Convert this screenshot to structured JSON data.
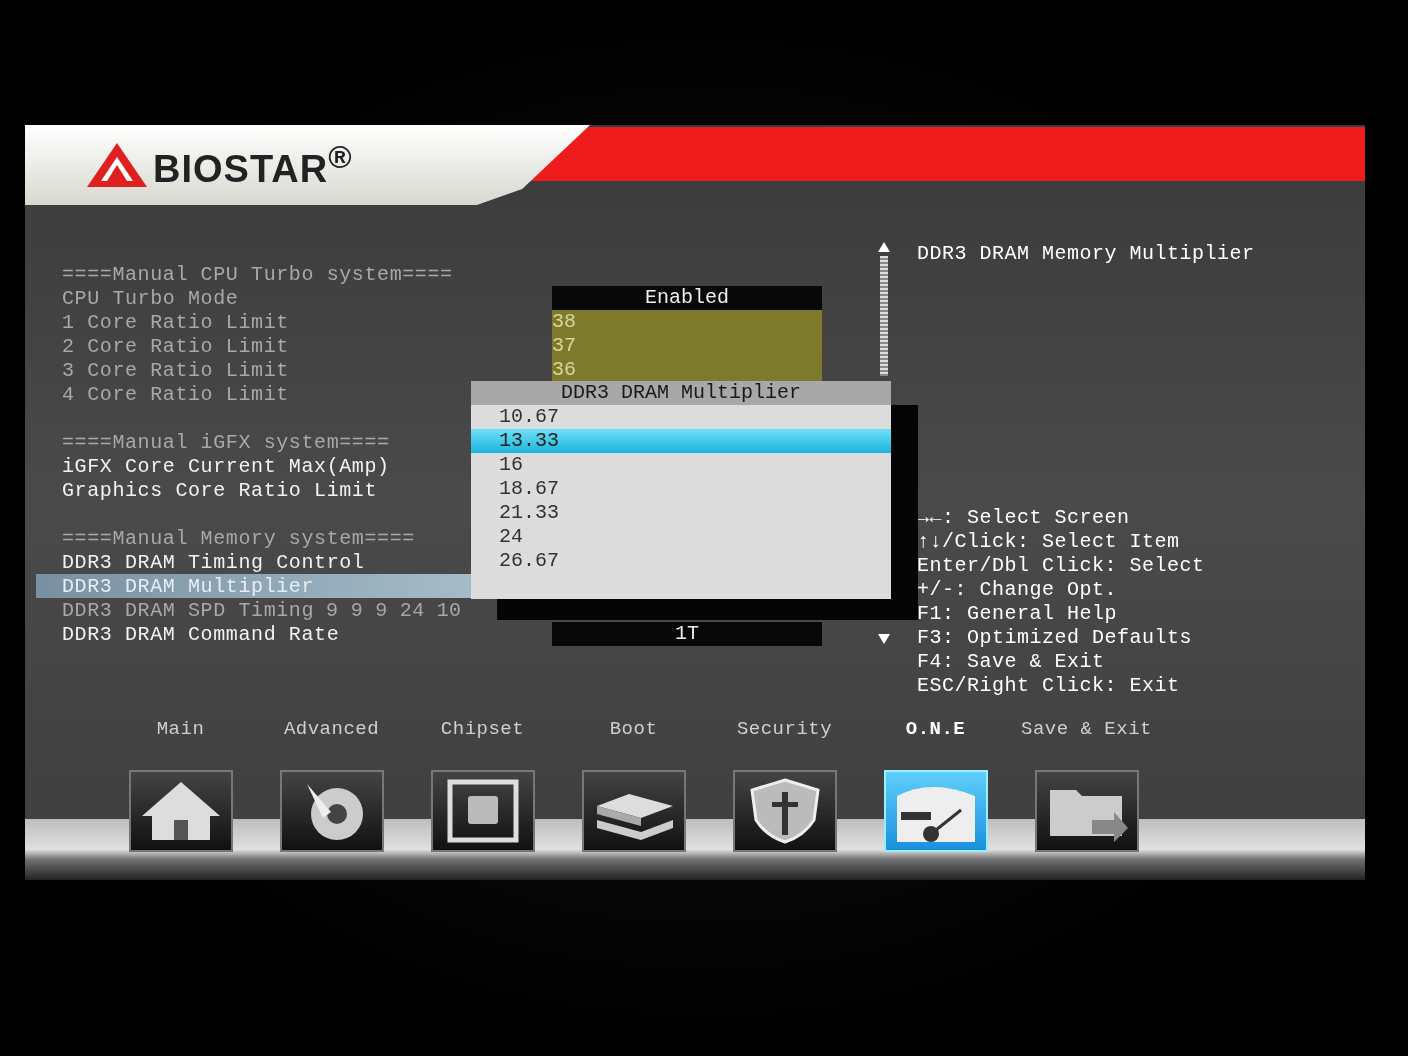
{
  "logo": {
    "text": "BIOSTAR$^{®}$"
  },
  "settings": [
    {
      "kind": "header",
      "label": "====Manual CPU Turbo system===="
    },
    {
      "kind": "item",
      "label": "CPU Turbo Mode",
      "disabled": true,
      "selected": false,
      "value": {
        "text": "Enabled",
        "kind": "dark"
      }
    },
    {
      "kind": "item",
      "label": "1 Core Ratio Limit",
      "disabled": true,
      "selected": false,
      "value": {
        "text": "38",
        "kind": "olive"
      }
    },
    {
      "kind": "item",
      "label": "2 Core Ratio Limit",
      "disabled": true,
      "selected": false,
      "value": {
        "text": "37",
        "kind": "olive"
      }
    },
    {
      "kind": "item",
      "label": "3 Core Ratio Limit",
      "disabled": true,
      "selected": false,
      "value": {
        "text": "36",
        "kind": "olive"
      }
    },
    {
      "kind": "item",
      "label": "4 Core Ratio Limit",
      "disabled": true,
      "selected": false
    },
    {
      "kind": "header",
      "label": "====Manual iGFX system===="
    },
    {
      "kind": "item",
      "label": "iGFX Core Current Max(Amp)",
      "disabled": false,
      "selected": false
    },
    {
      "kind": "item",
      "label": "Graphics Core Ratio Limit",
      "disabled": false,
      "selected": false
    },
    {
      "kind": "header",
      "label": "====Manual Memory system===="
    },
    {
      "kind": "item",
      "label": "DDR3 DRAM Timing Control",
      "disabled": false,
      "selected": false
    },
    {
      "kind": "item",
      "label": "DDR3 DRAM Multiplier",
      "disabled": false,
      "selected": true
    },
    {
      "kind": "item",
      "label": "DDR3 DRAM SPD Timing",
      "detail": "9 9 9 24 10",
      "disabled": true,
      "selected": false
    },
    {
      "kind": "item",
      "label": "DDR3 DRAM Command Rate",
      "disabled": false,
      "selected": false,
      "value": {
        "text": "1T",
        "kind": "dark"
      }
    }
  ],
  "popup": {
    "title": "DDR3 DRAM Multiplier",
    "options": [
      {
        "label": "10.67",
        "selected": false
      },
      {
        "label": "13.33",
        "selected": true
      },
      {
        "label": "16",
        "selected": false
      },
      {
        "label": "18.67",
        "selected": false
      },
      {
        "label": "21.33",
        "selected": false
      },
      {
        "label": "24",
        "selected": false
      },
      {
        "label": "26.67",
        "selected": false
      }
    ]
  },
  "help": {
    "title": "DDR3 DRAM Memory Multiplier",
    "keys": [
      "→←: Select Screen",
      "↑↓/Click: Select Item",
      "Enter/Dbl Click: Select",
      "+/-: Change Opt.",
      "F1: General Help",
      "F3: Optimized Defaults",
      "F4: Save & Exit",
      "ESC/Right Click: Exit"
    ]
  },
  "tabs": [
    {
      "label": "Main",
      "selected": false
    },
    {
      "label": "Advanced",
      "selected": false
    },
    {
      "label": "Chipset",
      "selected": false
    },
    {
      "label": "Boot",
      "selected": false
    },
    {
      "label": "Security",
      "selected": false
    },
    {
      "label": "O.N.E",
      "selected": true
    },
    {
      "label": "Save & Exit",
      "selected": false
    }
  ]
}
